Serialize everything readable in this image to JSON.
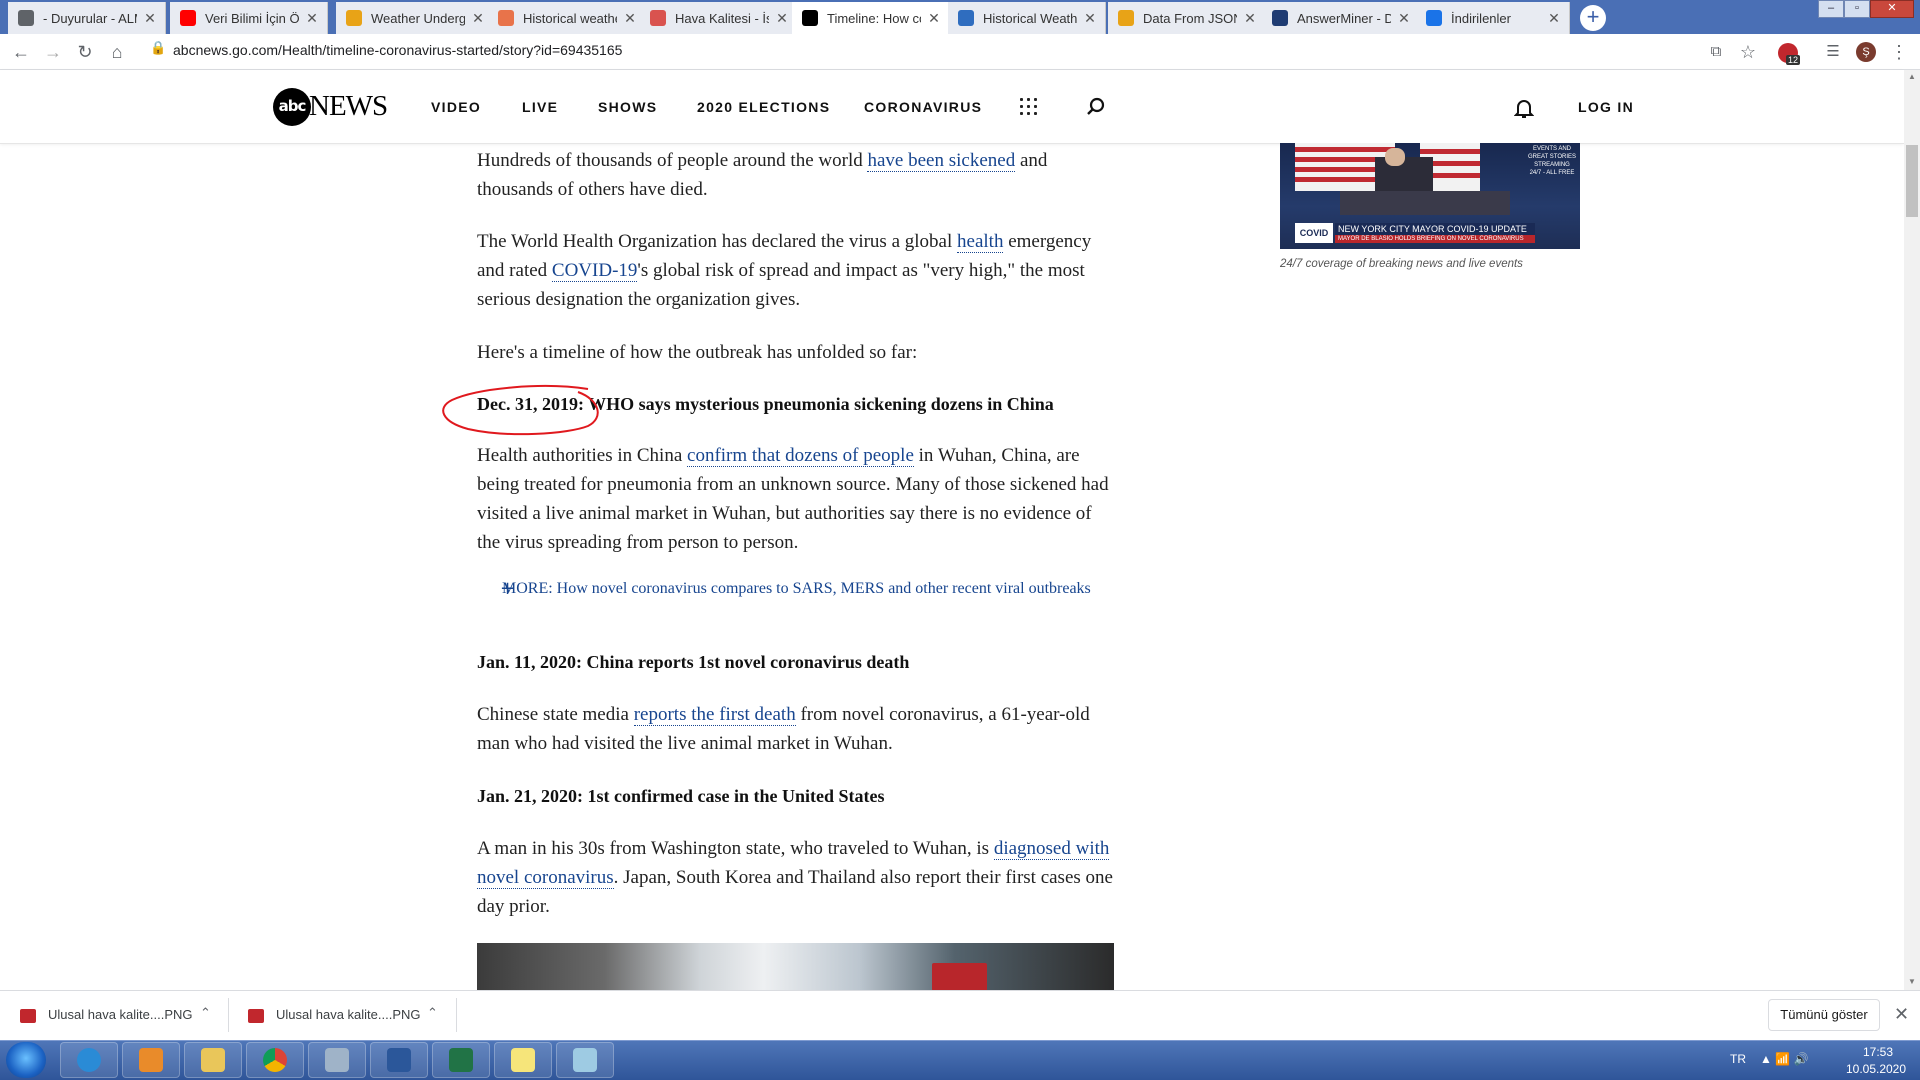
{
  "browser": {
    "tabs": [
      {
        "title": "- Duyurular - ALM",
        "icon": "globe-icon",
        "color": "#5f6368",
        "active": false
      },
      {
        "title": "Veri Bilimi İçin Ön",
        "icon": "youtube-icon",
        "color": "#ff0000",
        "active": false
      },
      {
        "title": "Weather Undergr",
        "icon": "chart-icon",
        "color": "#e8a317",
        "active": false
      },
      {
        "title": "Historical weathe",
        "icon": "weather-icon",
        "color": "#e8734a",
        "active": false
      },
      {
        "title": "Hava Kalitesi - İst",
        "icon": "air-quality-icon",
        "color": "#d9534f",
        "active": false
      },
      {
        "title": "Timeline: How co",
        "icon": "abc-icon",
        "color": "#000000",
        "active": true
      },
      {
        "title": "Historical Weathe",
        "icon": "chart-icon",
        "color": "#2f6dbf",
        "active": false
      },
      {
        "title": "Data From JSON",
        "icon": "chart-icon",
        "color": "#e8a317",
        "active": false
      },
      {
        "title": "AnswerMiner - D",
        "icon": "answerminer-icon",
        "color": "#1f3c73",
        "active": false
      },
      {
        "title": "İndirilenler",
        "icon": "download-icon",
        "color": "#1a73e8",
        "active": false
      }
    ],
    "new_tab": "+",
    "url": "abcnews.go.com/Health/timeline-coronavirus-started/story?id=69435165",
    "extension_badge": "12",
    "profile_initial": "Ş"
  },
  "site": {
    "logo_circle": "abc",
    "logo_word": "NEWS",
    "nav": [
      "VIDEO",
      "LIVE",
      "SHOWS",
      "2020 ELECTIONS",
      "CORONAVIRUS"
    ],
    "login": "LOG IN"
  },
  "article": {
    "p1": {
      "pre": "Hundreds of thousands of people around the world ",
      "link": "have been sickened",
      "post": " and thousands of others have died."
    },
    "p2": {
      "pre": "The World Health Organization has declared the virus a global ",
      "link1": "health",
      "mid": " emergency and rated ",
      "link2": "COVID-19",
      "post": "'s global risk of spread and impact as \"very high,\" the most serious designation the organization gives."
    },
    "p3": "Here's a timeline of how the outbreak has unfolded so far:",
    "h1": {
      "date": "Dec. 31, 2019:",
      "text": " WHO says mysterious pneumonia sickening dozens in China"
    },
    "p4": {
      "pre": "Health authorities in China ",
      "link": "confirm that dozens of people",
      "post": " in Wuhan, China, are being treated for pneumonia from an unknown source. Many of those sickened had visited a live animal market in Wuhan, but authorities say there is no evidence of the virus spreading from person to person."
    },
    "more": "MORE: How novel coronavirus compares to SARS, MERS and other recent viral outbreaks",
    "h2": "Jan. 11, 2020: China reports 1st novel coronavirus death",
    "p5": {
      "pre": "Chinese state media ",
      "link": "reports the first death",
      "post": " from novel coronavirus, a 61-year-old man who had visited the live animal market in Wuhan."
    },
    "h3": "Jan. 21, 2020: 1st confirmed case in the United States",
    "p6": {
      "pre": "A man in his 30s from Washington state, who traveled to Wuhan, is ",
      "link": "diagnosed with novel coronavirus",
      "post": ". Japan, South Korea and Thailand also report their first cases one day prior."
    }
  },
  "video": {
    "banner": "NEW YORK CITY MAYOR COVID-19 UPDATE",
    "sub": "MAYOR DE BLASIO HOLDS BRIEFING ON NOVEL CORONAVIRUS",
    "side_text": "EVENTS AND GREAT STORIES STREAMING 24/7 - ALL FREE",
    "caption": "24/7 coverage of breaking news and live events"
  },
  "downloads": {
    "items": [
      "Ulusal hava kalite....PNG",
      "Ulusal hava kalite....PNG"
    ],
    "show_all": "Tümünü göster"
  },
  "taskbar": {
    "lang": "TR",
    "time": "17:53",
    "date": "10.05.2020"
  },
  "colors": {
    "link": "#17458f",
    "annotation": "#e0191e",
    "taskbar": "#2f5599"
  }
}
